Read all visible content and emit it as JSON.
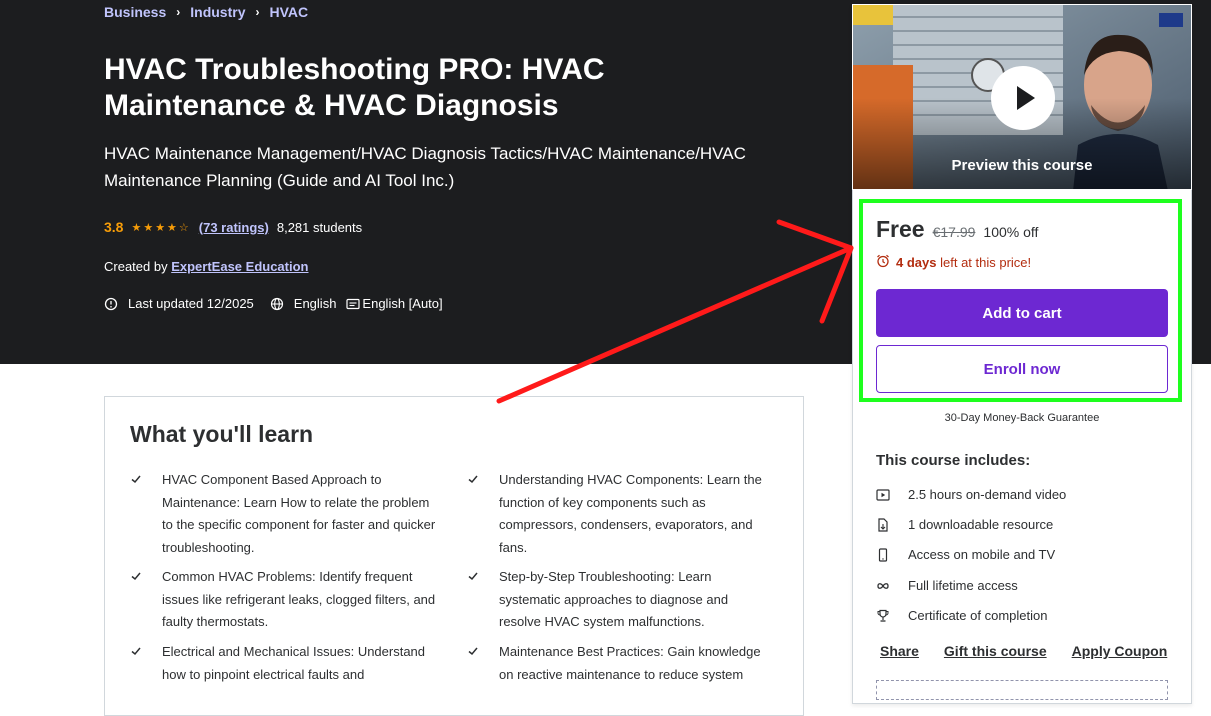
{
  "breadcrumb": [
    "Business",
    "Industry",
    "HVAC"
  ],
  "course": {
    "title": "HVAC Troubleshooting PRO: HVAC Maintenance & HVAC Diagnosis",
    "subtitle": "HVAC Maintenance Management/HVAC Diagnosis Tactics/HVAC Maintenance/HVAC Maintenance Planning (Guide and AI Tool Inc.)",
    "rating": "3.8",
    "stars": "★★★★☆",
    "ratings_count": "(73 ratings)",
    "students": "8,281 students",
    "created_by_label": "Created by",
    "instructor": "ExpertEase Education",
    "last_updated": "Last updated 12/2025",
    "language": "English",
    "captions": "English [Auto]"
  },
  "learn": {
    "title": "What you'll learn",
    "items": [
      "HVAC Component Based Approach to Maintenance: Learn How to relate the problem to the specific component for faster and quicker troubleshooting.",
      "Understanding HVAC Components: Learn the function of key components such as compressors, condensers, evaporators, and fans.",
      "Common HVAC Problems: Identify frequent issues like refrigerant leaks, clogged filters, and faulty thermostats.",
      "Step-by-Step Troubleshooting: Learn systematic approaches to diagnose and resolve HVAC system malfunctions.",
      "Electrical and Mechanical Issues: Understand how to pinpoint electrical faults and",
      "Maintenance Best Practices: Gain knowledge on reactive maintenance to reduce system"
    ]
  },
  "sidebar": {
    "preview_label": "Preview this course",
    "price": "Free",
    "original_price": "€17.99",
    "discount": "100% off",
    "timer_bold": "4 days",
    "timer_rest": "left at this price!",
    "add_to_cart": "Add to cart",
    "enroll_now": "Enroll now",
    "guarantee": "30-Day Money-Back Guarantee",
    "includes_title": "This course includes:",
    "includes": [
      {
        "icon": "video-icon",
        "text": "2.5 hours on-demand video"
      },
      {
        "icon": "file-download-icon",
        "text": "1 downloadable resource"
      },
      {
        "icon": "mobile-icon",
        "text": "Access on mobile and TV"
      },
      {
        "icon": "infinity-icon",
        "text": "Full lifetime access"
      },
      {
        "icon": "trophy-icon",
        "text": "Certificate of completion"
      }
    ],
    "links": [
      "Share",
      "Gift this course",
      "Apply Coupon"
    ]
  },
  "colors": {
    "hero_bg": "#1c1d1f",
    "accent": "#6d28d2",
    "link": "#c0c4fc",
    "star": "#f69c08",
    "highlight": "#1eff1e",
    "arrow": "#ff1a1a",
    "timer": "#b32d0f"
  }
}
